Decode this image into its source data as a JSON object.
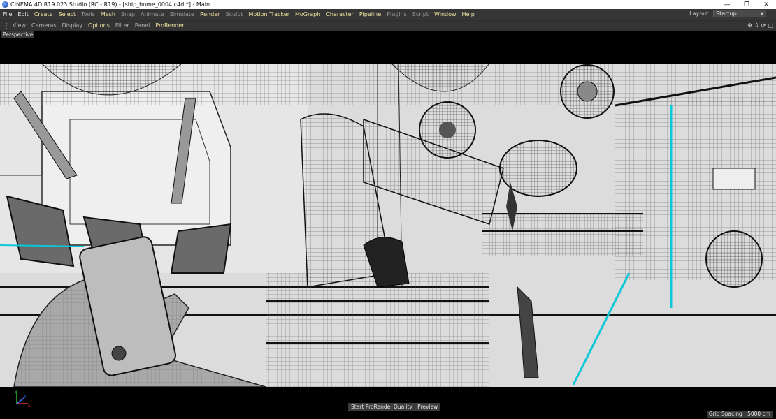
{
  "titlebar": {
    "title": "CINEMA 4D R19.023 Studio (RC - R19) - [ship_home_0004.c4d *] - Main",
    "minimize": "—",
    "maximize": "❐",
    "close": "✕"
  },
  "menubar": {
    "items": [
      {
        "label": "File",
        "style": "white"
      },
      {
        "label": "Edit",
        "style": "white"
      },
      {
        "label": "Create",
        "style": "yellow"
      },
      {
        "label": "Select",
        "style": "yellow"
      },
      {
        "label": "Tools",
        "style": "gray"
      },
      {
        "label": "Mesh",
        "style": "yellow"
      },
      {
        "label": "Snap",
        "style": "gray"
      },
      {
        "label": "Animate",
        "style": "gray"
      },
      {
        "label": "Simulate",
        "style": "gray"
      },
      {
        "label": "Render",
        "style": "yellow"
      },
      {
        "label": "Sculpt",
        "style": "gray"
      },
      {
        "label": "Motion Tracker",
        "style": "yellow"
      },
      {
        "label": "MoGraph",
        "style": "yellow"
      },
      {
        "label": "Character",
        "style": "yellow"
      },
      {
        "label": "Pipeline",
        "style": "yellow"
      },
      {
        "label": "Plugins",
        "style": "gray"
      },
      {
        "label": "Script",
        "style": "gray"
      },
      {
        "label": "Window",
        "style": "yellow"
      },
      {
        "label": "Help",
        "style": "yellow"
      }
    ],
    "layout_label": "Layout:",
    "layout_value": "Startup"
  },
  "viewport_menu": {
    "items": [
      {
        "label": "View",
        "style": "gray"
      },
      {
        "label": "Cameras",
        "style": "gray"
      },
      {
        "label": "Display",
        "style": "gray"
      },
      {
        "label": "Options",
        "style": "yellow"
      },
      {
        "label": "Filter",
        "style": "gray"
      },
      {
        "label": "Panel",
        "style": "gray"
      },
      {
        "label": "ProRender",
        "style": "yellow"
      }
    ],
    "nav_icons": [
      "move-icon",
      "zoom-icon",
      "rotate-icon",
      "maximize-view-icon"
    ]
  },
  "viewport": {
    "camera_label": "Perspective",
    "start_prorender": "Start ProRender",
    "quality": "Quality : Preview",
    "grid_spacing": "Grid Spacing : 5000 cm",
    "axis": {
      "y": "y",
      "x": "x",
      "z": "z"
    }
  },
  "colors": {
    "accent_yellow": "#f0e1a0",
    "axis_x": "#e03030",
    "axis_y": "#30c030",
    "axis_z": "#3a6cff"
  }
}
